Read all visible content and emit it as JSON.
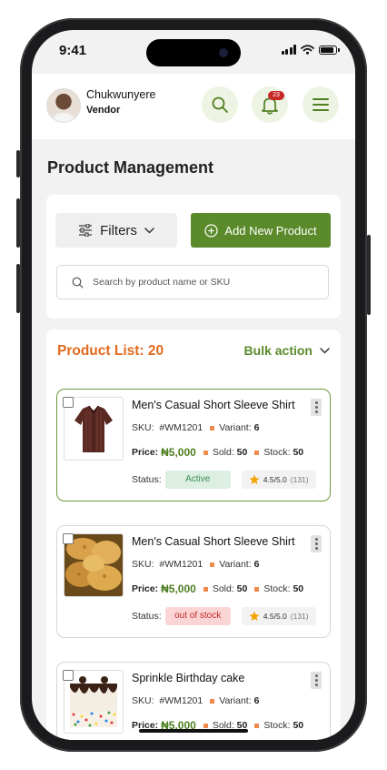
{
  "status_bar": {
    "time": "9:41"
  },
  "header": {
    "user_name": "Chukwunyere",
    "user_role": "Vendor",
    "notification_count": "23"
  },
  "page": {
    "title": "Product Management"
  },
  "filters": {
    "filters_label": "Filters",
    "add_label": "Add New Product",
    "search_placeholder": "Search by product name or SKU"
  },
  "list": {
    "count_label": "Product List: 20",
    "bulk_label": "Bulk action"
  },
  "products": [
    {
      "name": "Men's Casual Short Sleeve Shirt",
      "sku_label": "SKU:",
      "sku": "#WM1201",
      "variant_label": "Variant:",
      "variant": "6",
      "price_label": "Price:",
      "price": "₦5,000",
      "sold_label": "Sold:",
      "sold": "50",
      "stock_label": "Stock:",
      "stock": "50",
      "status_label": "Status:",
      "status": "Active",
      "rating": "4.5/5.0",
      "reviews": "(131)",
      "image": "shirt-image",
      "selected": true
    },
    {
      "name": "Men's Casual Short Sleeve Shirt",
      "sku_label": "SKU:",
      "sku": "#WM1201",
      "variant_label": "Variant:",
      "variant": "6",
      "price_label": "Price:",
      "price": "₦5,000",
      "sold_label": "Sold:",
      "sold": "50",
      "stock_label": "Stock:",
      "stock": "50",
      "status_label": "Status:",
      "status": "out of stock",
      "rating": "4.5/5.0",
      "reviews": "(131)",
      "image": "pastry-image",
      "selected": false
    },
    {
      "name": "Sprinkle Birthday cake",
      "sku_label": "SKU:",
      "sku": "#WM1201",
      "variant_label": "Variant:",
      "variant": "6",
      "price_label": "Price:",
      "price": "₦5,000",
      "sold_label": "Sold:",
      "sold": "50",
      "stock_label": "Stock:",
      "stock": "50",
      "image": "cake-image",
      "selected": false
    }
  ],
  "colors": {
    "primary_green": "#5b8a2b",
    "accent_orange": "#e26a1e",
    "active_bg": "#dcefe2",
    "out_of_stock_bg": "#fbd5d5",
    "badge_red": "#c62828"
  }
}
